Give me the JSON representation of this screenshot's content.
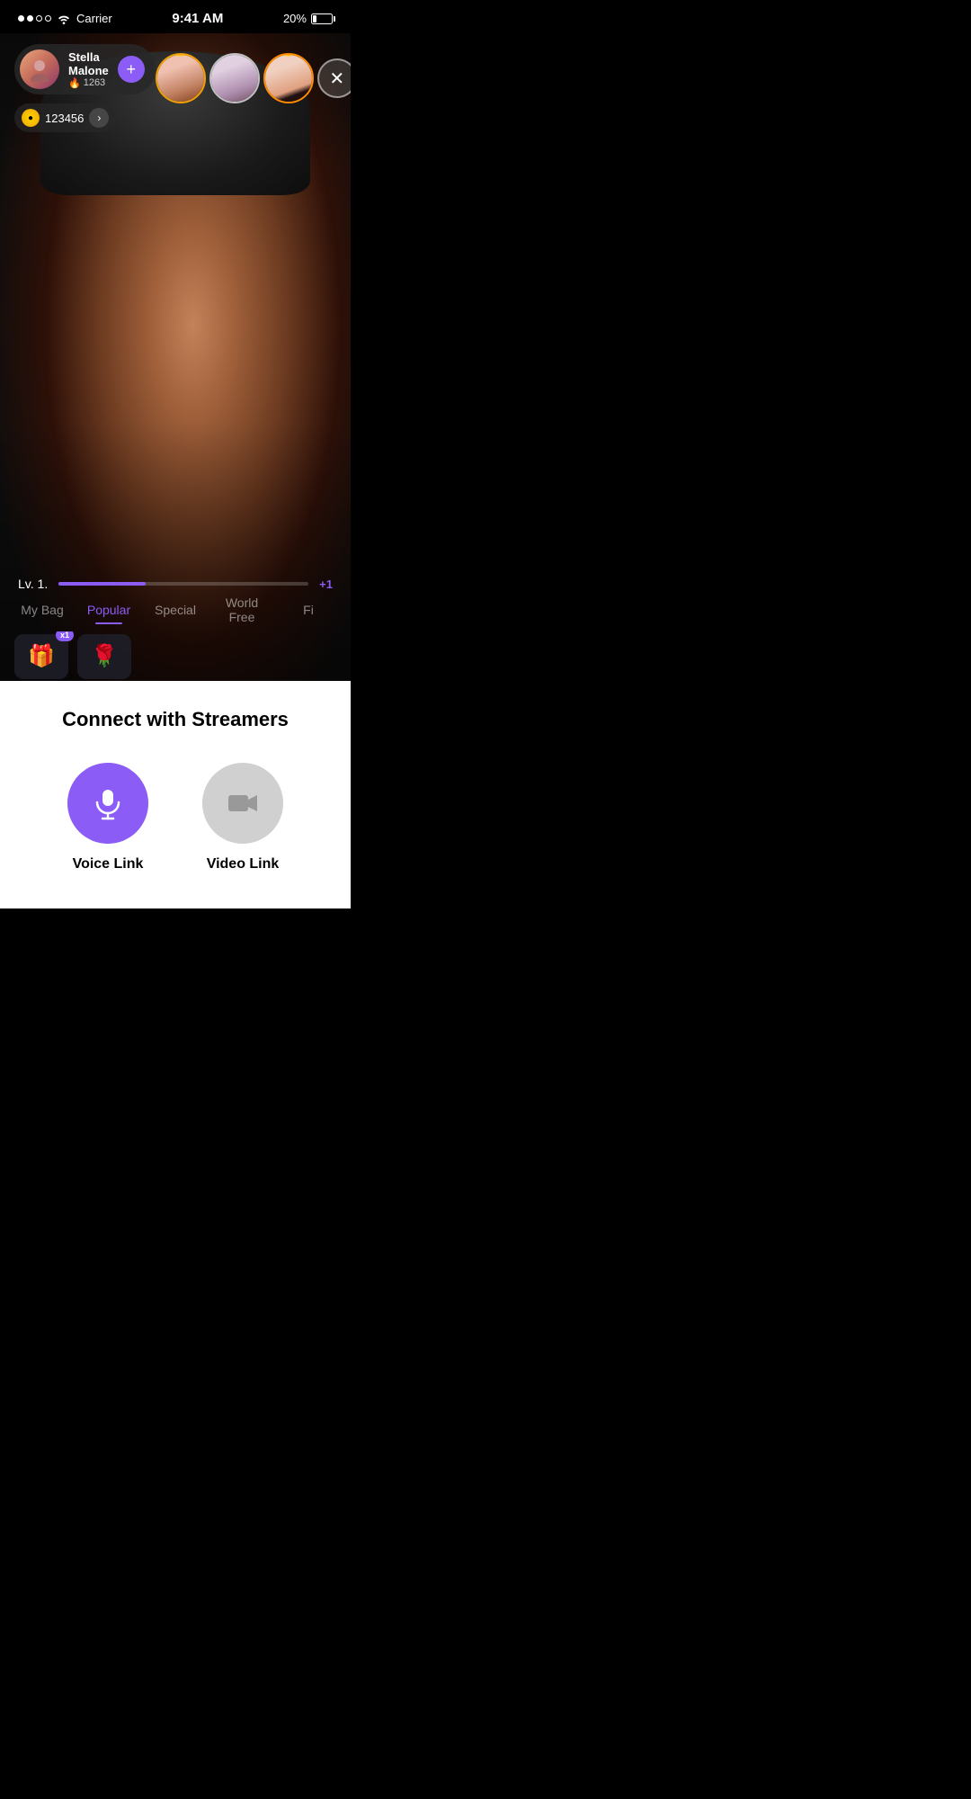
{
  "statusBar": {
    "carrier": "Carrier",
    "time": "9:41 AM",
    "battery": "20%"
  },
  "streamer": {
    "name": "Stella Malone",
    "score": "1263",
    "coins": "123456",
    "followLabel": "+"
  },
  "viewers": [
    {
      "id": 1,
      "crownType": "gold",
      "crown": "👑"
    },
    {
      "id": 2,
      "crownType": "silver",
      "crown": "♛"
    },
    {
      "id": 3,
      "crownType": "orange",
      "crown": "👑"
    }
  ],
  "level": {
    "label": "Lv. 1.",
    "plusLabel": "+1",
    "fillPercent": 35
  },
  "tabs": [
    {
      "id": "my-bag",
      "label": "My Bag",
      "active": false
    },
    {
      "id": "popular",
      "label": "Popular",
      "active": true
    },
    {
      "id": "special",
      "label": "Special",
      "active": false
    },
    {
      "id": "world-free",
      "label": "World Free",
      "active": false
    },
    {
      "id": "fi",
      "label": "Fi",
      "active": false
    }
  ],
  "giftBadge": "x1",
  "bottomPanel": {
    "title": "Connect with Streamers",
    "voiceLink": "Voice Link",
    "videoLink": "Video Link"
  },
  "colors": {
    "accent": "#8b5cf6",
    "voiceBtn": "#8b5cf6",
    "videoBtn": "#d0d0d0"
  }
}
